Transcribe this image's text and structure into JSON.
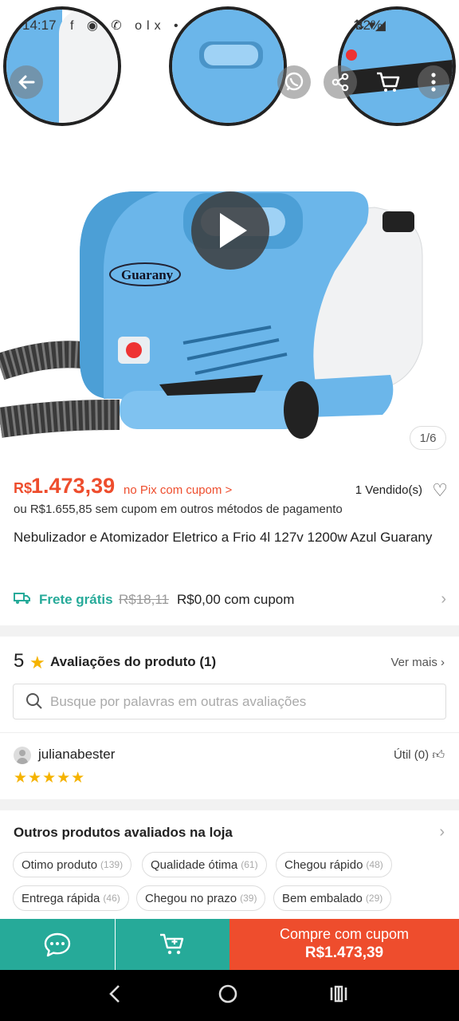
{
  "status_bar": {
    "time": "14:17",
    "icons": "f ◉ ✆ olx •",
    "signal": "⇅ ▾◢",
    "battery": "32%"
  },
  "gallery": {
    "counter": "1/6",
    "brand_logo_text": "Guarany"
  },
  "price": {
    "currency": "R$",
    "value": "1.473,39",
    "note": "no Pix com cupom >",
    "sold": "1 Vendido(s)",
    "alt": "ou R$1.655,85 sem cupom em outros métodos de pagamento"
  },
  "product": {
    "title": "Nebulizador e Atomizador Eletrico a Frio 4l 127v 1200w Azul Guarany"
  },
  "shipping": {
    "free_label": "Frete grátis",
    "old_price": "R$18,11",
    "new_price": "R$0,00 com cupom"
  },
  "reviews": {
    "score": "5",
    "label": "Avaliações do produto (1)",
    "more": "Ver mais",
    "search_placeholder": "Busque por palavras em outras avaliações",
    "reviewer_name": "julianabester",
    "useful": "Útil (0)",
    "rating": 5,
    "stars": "★★★★★"
  },
  "other_products": {
    "title": "Outros produtos avaliados na loja",
    "chips": [
      {
        "label": "Otimo produto",
        "count": "(139)"
      },
      {
        "label": "Qualidade ótima",
        "count": "(61)"
      },
      {
        "label": "Chegou rápido",
        "count": "(48)"
      },
      {
        "label": "Entrega rápida",
        "count": "(46)"
      },
      {
        "label": "Chegou no prazo",
        "count": "(39)"
      },
      {
        "label": "Bem embalado",
        "count": "(29)"
      }
    ]
  },
  "buy_bar": {
    "line1": "Compre com cupom",
    "line2": "R$1.473,39"
  },
  "colors": {
    "accent": "#ee4d2d",
    "teal": "#26aa99",
    "star": "#f5b301",
    "product_blue": "#6bb6ea"
  }
}
